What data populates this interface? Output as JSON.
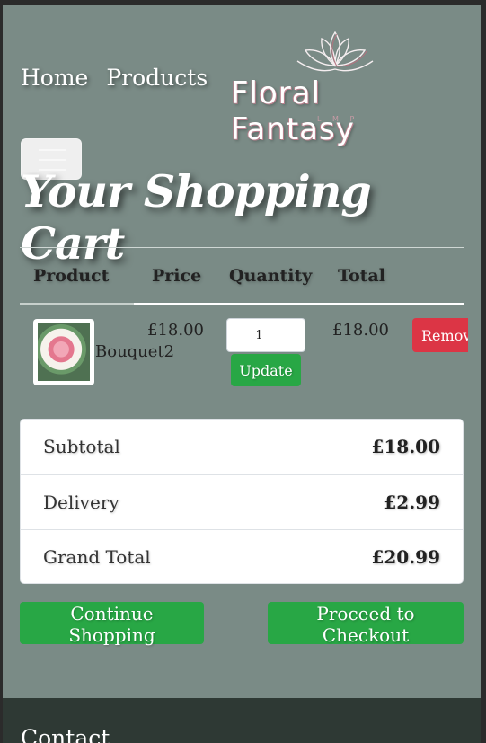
{
  "nav": {
    "links": [
      "Home",
      "Products"
    ]
  },
  "logo": {
    "name": "Floral Fantasy",
    "subtitle": "L M P"
  },
  "cart": {
    "title": "Your Shopping Cart",
    "headers": [
      "Product",
      "Price",
      "Quantity",
      "Total"
    ],
    "item": {
      "name": "Bouquet2",
      "price": "£18.00",
      "quantity": "1",
      "total": "£18.00",
      "update_label": "Update",
      "remove_label": "Remove"
    }
  },
  "summary": {
    "rows": [
      {
        "label": "Subtotal",
        "value": "£18.00"
      },
      {
        "label": "Delivery",
        "value": "£2.99"
      },
      {
        "label": "Grand Total",
        "value": "£20.99"
      }
    ]
  },
  "actions": {
    "continue_label": "Continue Shopping",
    "checkout_label": "Proceed to Checkout"
  },
  "footer": {
    "title": "Contact"
  },
  "colors": {
    "page_bg": "#7a8b86",
    "green": "#28a745",
    "red": "#dc3545",
    "footer_bg": "#2e3934"
  }
}
